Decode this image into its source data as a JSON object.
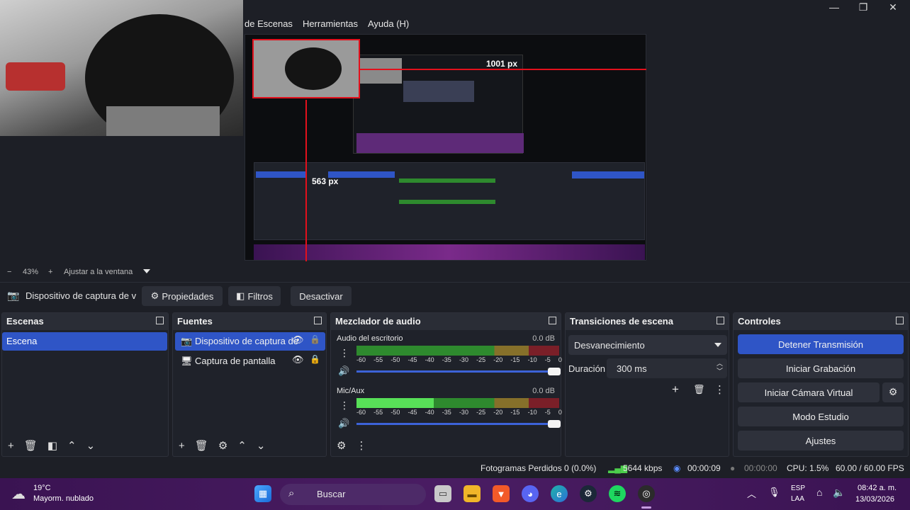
{
  "menu": [
    "de Escenas",
    "Herramientas",
    "Ayuda (H)"
  ],
  "window_controls": {
    "minimize": "—",
    "maximize": "❐",
    "close": "✕"
  },
  "preview": {
    "width_readout": "1001 px",
    "height_readout": "563 px"
  },
  "zoom": {
    "minus": "−",
    "percent": "43%",
    "plus": "+",
    "fit_label": "Ajustar a la ventana"
  },
  "context": {
    "source_name": "Dispositivo de captura de v",
    "properties": "Propiedades",
    "filters": "Filtros",
    "deactivate": "Desactivar"
  },
  "scenes": {
    "title": "Escenas",
    "items": [
      "Escena"
    ]
  },
  "sources": {
    "title": "Fuentes",
    "items": [
      "Dispositivo de captura de",
      "Captura de pantalla"
    ]
  },
  "mixer": {
    "title": "Mezclador de audio",
    "channels": [
      {
        "name": "Audio del escritorio",
        "db": "0.0 dB",
        "level": 0.0
      },
      {
        "name": "Mic/Aux",
        "db": "0.0 dB",
        "level": 0.38
      }
    ],
    "ticks": [
      "-60",
      "-55",
      "-50",
      "-45",
      "-40",
      "-35",
      "-30",
      "-25",
      "-20",
      "-15",
      "-10",
      "-5",
      "0"
    ]
  },
  "transitions": {
    "title": "Transiciones de escena",
    "selected": "Desvanecimiento",
    "duration_label": "Duración",
    "duration_value": "300 ms"
  },
  "controls": {
    "title": "Controles",
    "buttons": [
      "Detener Transmisión",
      "Iniciar Grabación",
      "Iniciar Cámara Virtual",
      "Modo Estudio",
      "Ajustes"
    ]
  },
  "status": {
    "dropped": "Fotogramas Perdidos 0 (0.0%)",
    "bitrate": "5644 kbps",
    "stream_time": "00:00:09",
    "rec_time": "00:00:00",
    "cpu": "CPU: 1.5%",
    "fps": "60.00 / 60.00 FPS"
  },
  "taskbar": {
    "weather_temp": "19°C",
    "weather_desc": "Mayorm. nublado",
    "search_placeholder": "Buscar",
    "lang_top": "ESP",
    "lang_bottom": "LAA",
    "time": "08:42 a. m.",
    "date": "13/03/2026"
  },
  "colors": {
    "accent": "#2f55c6",
    "guide": "#e3101c",
    "taskbar": "#3a1352"
  }
}
